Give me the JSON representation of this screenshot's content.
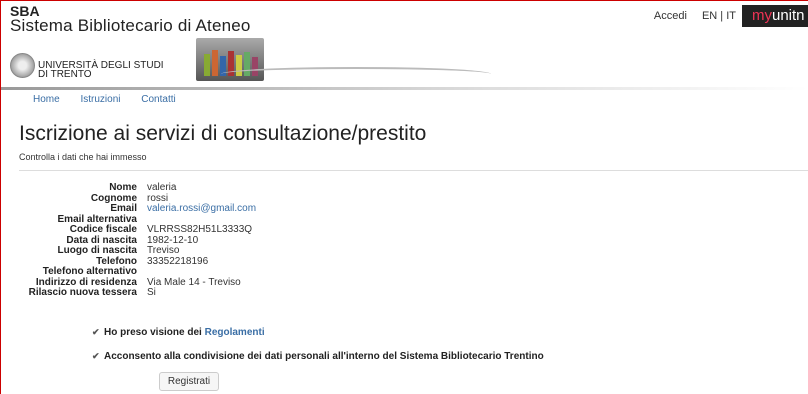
{
  "header": {
    "sba": "SBA",
    "system_name": "Sistema Bibliotecario di Ateneo",
    "university_line1": "UNIVERSITÀ DEGLI STUDI",
    "university_line2": "DI TRENTO",
    "accedi": "Accedi",
    "lang": "EN | IT",
    "myunitn_prefix": "my",
    "myunitn_suffix": "unitn"
  },
  "nav": [
    "Home",
    "Istruzioni",
    "Contatti"
  ],
  "page": {
    "title": "Iscrizione ai servizi di consultazione/prestito",
    "subtitle": "Controlla i dati che hai immesso"
  },
  "fields": [
    {
      "label": "Nome",
      "value": "valeria"
    },
    {
      "label": "Cognome",
      "value": "rossi"
    },
    {
      "label": "Email",
      "value": "valeria.rossi@gmail.com"
    },
    {
      "label": "Email alternativa",
      "value": ""
    },
    {
      "label": "Codice fiscale",
      "value": "VLRRSS82H51L3333Q"
    },
    {
      "label": "Data di nascita",
      "value": "1982-12-10"
    },
    {
      "label": "Luogo di nascita",
      "value": "Treviso"
    },
    {
      "label": "Telefono",
      "value": "33352218196"
    },
    {
      "label": "Telefono alternativo",
      "value": ""
    },
    {
      "label": "Indirizzo di residenza",
      "value": "Via Male 14 - Treviso"
    },
    {
      "label": "Rilascio nuova tessera",
      "value": "Si"
    }
  ],
  "consent1": {
    "text": "Ho preso visione dei ",
    "link": "Regolamenti"
  },
  "consent2": {
    "text": "Acconsento alla condivisione dei dati personali all'interno del Sistema Bibliotecario Trentino"
  },
  "submit_label": "Registrati"
}
